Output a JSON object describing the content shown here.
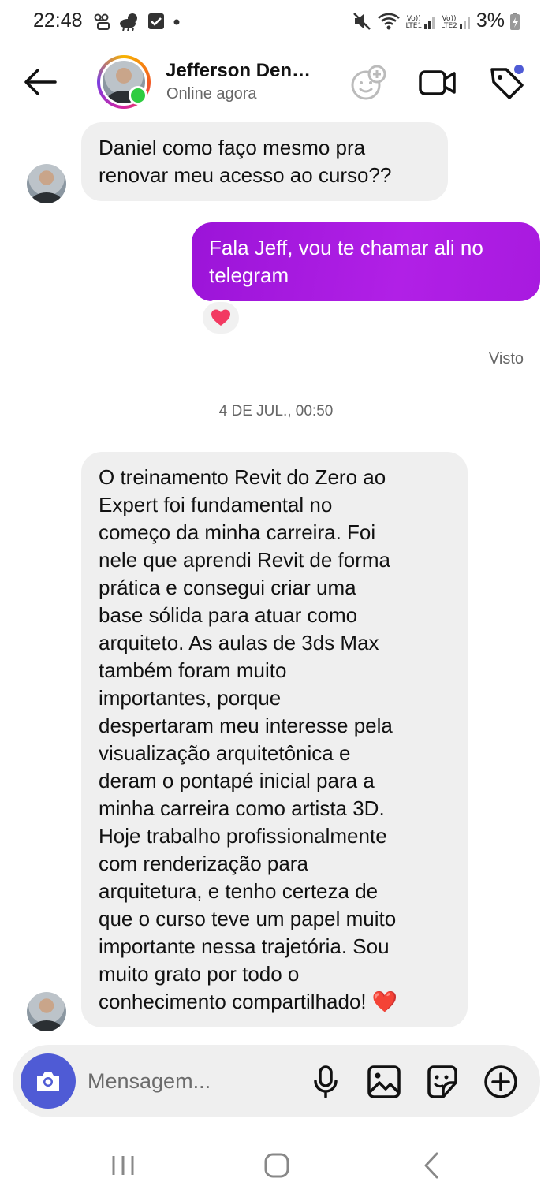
{
  "status_bar": {
    "time": "22:48",
    "battery": "3%",
    "sim1": "LTE1",
    "sim2": "LTE2",
    "volte": "Vo))"
  },
  "header": {
    "contact_name": "Jefferson Den…",
    "contact_status": "Online agora",
    "icons": [
      "back-arrow-icon",
      "sticker-add-icon",
      "video-camera-icon",
      "tag-icon"
    ],
    "tag_badge_color": "#4f5bd5"
  },
  "messages": [
    {
      "direction": "incoming",
      "text_lines": [
        "Daniel como faço mesmo pra",
        "renovar meu acesso ao curso??"
      ]
    },
    {
      "direction": "outgoing",
      "text_lines": [
        "Fala Jeff, vou te chamar ali no",
        "telegram"
      ],
      "reaction": "❤️"
    },
    {
      "direction": "incoming",
      "text_lines": [
        "O treinamento Revit do Zero ao",
        "Expert foi fundamental no",
        "começo da minha carreira. Foi",
        "nele que aprendi Revit de forma",
        "prática e consegui criar uma",
        "base sólida para atuar como",
        "arquiteto. As aulas de 3ds Max",
        "também foram muito",
        "importantes, porque",
        "despertaram meu interesse pela",
        "visualização arquitetônica e",
        "deram o pontapé inicial para a",
        "minha carreira como artista 3D.",
        "Hoje trabalho profissionalmente",
        "com renderização para",
        "arquitetura, e tenho certeza de",
        "que o curso teve um papel muito",
        "importante nessa trajetória. Sou",
        "muito grato por todo o",
        "conhecimento compartilhado! ❤️"
      ]
    }
  ],
  "seen_label": "Visto",
  "date_separator": "4 DE JUL., 00:50",
  "composer": {
    "placeholder": "Mensagem...",
    "icons": [
      "camera-icon",
      "microphone-icon",
      "gallery-icon",
      "sticker-icon",
      "add-icon"
    ],
    "camera_color": "#4f5bd5"
  },
  "colors": {
    "outgoing_bubble": "#a81adf",
    "incoming_bubble": "#efefef",
    "online": "#2ecc40"
  }
}
